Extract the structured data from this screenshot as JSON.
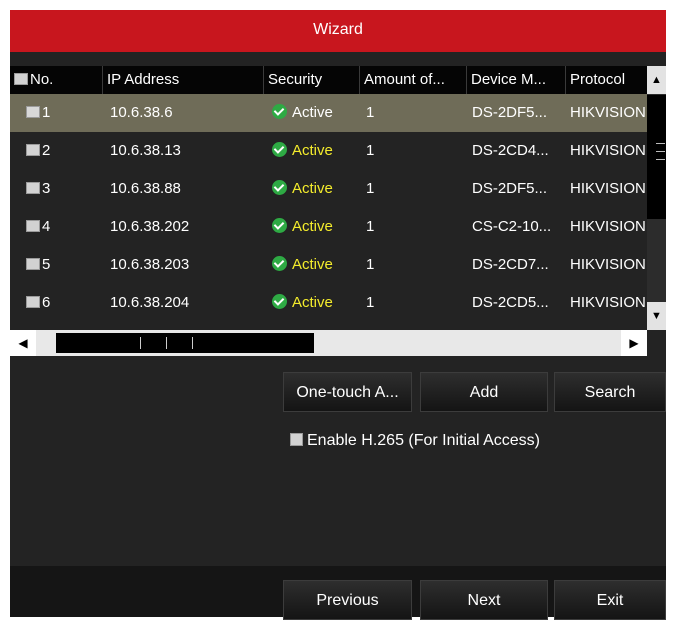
{
  "title": "Wizard",
  "table": {
    "headers": [
      "No.",
      "IP Address",
      "Security",
      "Amount of...",
      "Device M...",
      "Protocol"
    ],
    "rows": [
      {
        "no": "1",
        "ip": "10.6.38.6",
        "security": "Active",
        "amount": "1",
        "model": "DS-2DF5...",
        "protocol": "HIKVISION",
        "selected": true
      },
      {
        "no": "2",
        "ip": "10.6.38.13",
        "security": "Active",
        "amount": "1",
        "model": "DS-2CD4...",
        "protocol": "HIKVISION",
        "selected": false
      },
      {
        "no": "3",
        "ip": "10.6.38.88",
        "security": "Active",
        "amount": "1",
        "model": "DS-2DF5...",
        "protocol": "HIKVISION",
        "selected": false
      },
      {
        "no": "4",
        "ip": "10.6.38.202",
        "security": "Active",
        "amount": "1",
        "model": "CS-C2-10...",
        "protocol": "HIKVISION",
        "selected": false
      },
      {
        "no": "5",
        "ip": "10.6.38.203",
        "security": "Active",
        "amount": "1",
        "model": "DS-2CD7...",
        "protocol": "HIKVISION",
        "selected": false
      },
      {
        "no": "6",
        "ip": "10.6.38.204",
        "security": "Active",
        "amount": "1",
        "model": "DS-2CD5...",
        "protocol": "HIKVISION",
        "selected": false
      }
    ]
  },
  "actions": {
    "one_touch": "One-touch A...",
    "add": "Add",
    "search": "Search"
  },
  "options": {
    "h265_label": "Enable H.265 (For Initial Access)",
    "h265_checked": false
  },
  "footer": {
    "previous": "Previous",
    "next": "Next",
    "exit": "Exit"
  },
  "scroll_icons": {
    "up": "chevron-up-icon",
    "down": "chevron-down-icon",
    "left": "chevron-left-icon",
    "right": "chevron-right-icon"
  },
  "colors": {
    "title_bar": "#c8161e",
    "selected_row": "#6f6c58",
    "active_status": "#f4ec2c",
    "status_icon": "#2eaa44"
  }
}
